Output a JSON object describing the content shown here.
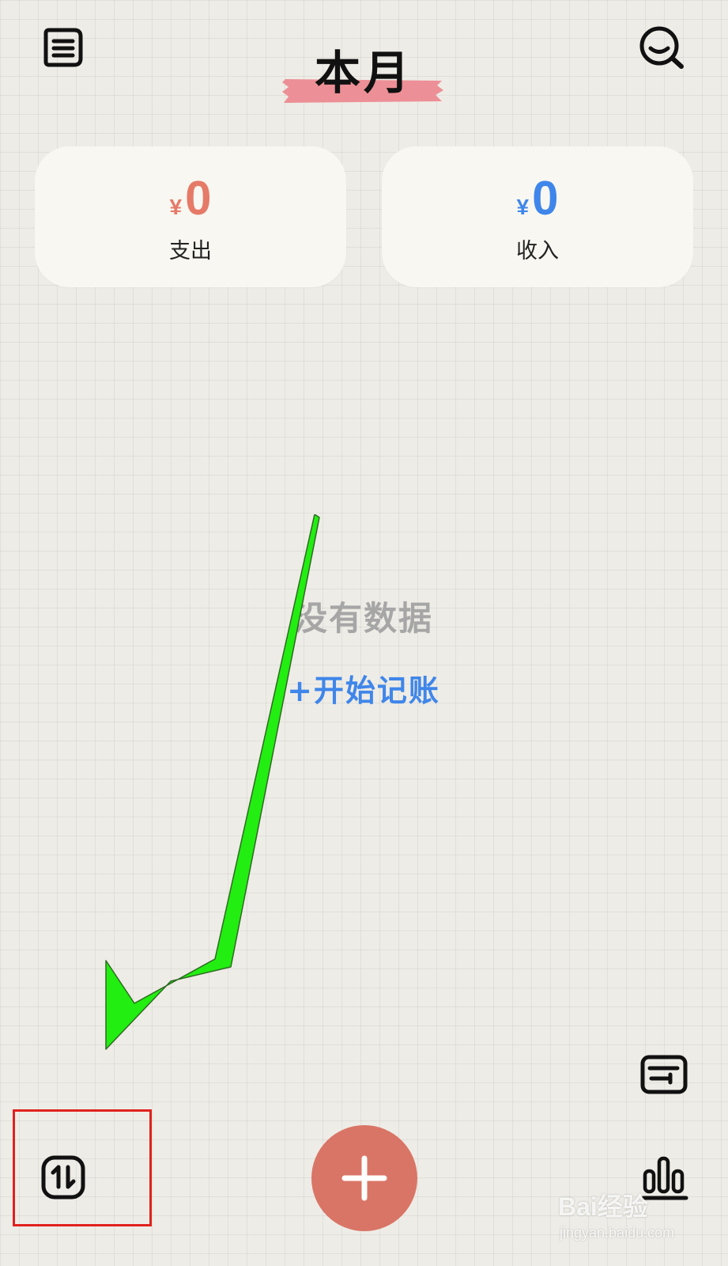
{
  "header": {
    "title": "本月",
    "tape_color": "#ec8f96"
  },
  "summary": {
    "expense": {
      "currency": "¥",
      "amount": "0",
      "label": "支出",
      "color": "#e67a68"
    },
    "income": {
      "currency": "¥",
      "amount": "0",
      "label": "收入",
      "color": "#3f86ea"
    }
  },
  "empty_state": {
    "message": "没有数据",
    "action_label": "+开始记账"
  },
  "bottom_bar": {
    "left_icon": "swap-icon",
    "add_icon": "plus-icon",
    "right_icons": [
      "wallet-icon",
      "bar-chart-icon"
    ],
    "add_color": "#d97566"
  },
  "annotations": {
    "arrow_color": "#22ee11",
    "highlight_color": "#e0221e"
  },
  "watermark": {
    "main": "Bai经验",
    "sub": "jingyan.baidu.com"
  }
}
